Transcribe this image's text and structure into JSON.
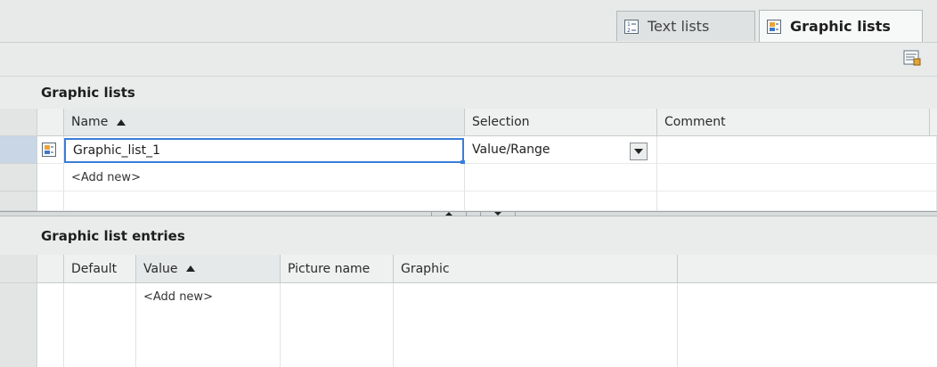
{
  "tabs": [
    {
      "label": "Text lists",
      "icon": "text-list-icon",
      "active": false
    },
    {
      "label": "Graphic lists",
      "icon": "graphic-list-icon",
      "active": true
    }
  ],
  "toolbar": {
    "icon": "properties-icon"
  },
  "graphic_lists": {
    "title": "Graphic lists",
    "columns": {
      "name": "Name",
      "selection": "Selection",
      "comment": "Comment"
    },
    "rows": [
      {
        "name": "Graphic_list_1",
        "selection": "Value/Range",
        "comment": ""
      }
    ],
    "add_new": "<Add new>"
  },
  "entries": {
    "title": "Graphic list entries",
    "columns": {
      "default": "Default",
      "value": "Value",
      "picture_name": "Picture name",
      "graphic": "Graphic"
    },
    "add_new": "<Add new>"
  },
  "colors": {
    "accent": "#3b7dd8",
    "selected_row_header": "#c9d6e6"
  }
}
